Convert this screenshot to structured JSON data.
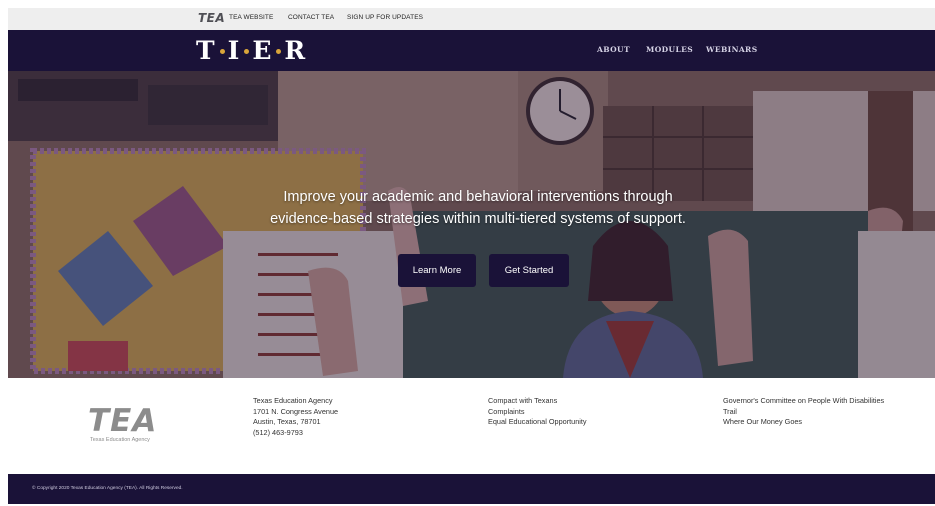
{
  "topbar": {
    "logo": "TEA",
    "links": [
      "TEA WEBSITE",
      "CONTACT TEA",
      "SIGN UP FOR UPDATES"
    ]
  },
  "nav": {
    "brand_letters": [
      "T",
      "I",
      "E",
      "R"
    ],
    "links": [
      "ABOUT",
      "MODULES",
      "WEBINARS"
    ]
  },
  "hero": {
    "line1": "Improve your academic and behavioral interventions through",
    "line2": "evidence-based strategies within multi-tiered systems of support.",
    "learn_more": "Learn More",
    "get_started": "Get Started"
  },
  "footer": {
    "logo_text": "TEA",
    "logo_sub": "Texas Education Agency",
    "address": [
      "Texas Education Agency",
      "1701 N. Congress Avenue",
      "Austin, Texas, 78701",
      "(512) 463-9793"
    ],
    "links_col2": [
      "Compact with Texans",
      "Complaints",
      "Equal Educational Opportunity"
    ],
    "links_col3": [
      "Governor's Committee on People With Disabilities",
      "Trail",
      "Where Our Money Goes"
    ]
  },
  "copyright": "© Copyright 2020 Texas Education Agency (TEA). All Rights Reserved.",
  "colors": {
    "navy": "#1a1238",
    "gold_accent": "#d9a53a",
    "topbar_bg": "#eeeeee"
  }
}
